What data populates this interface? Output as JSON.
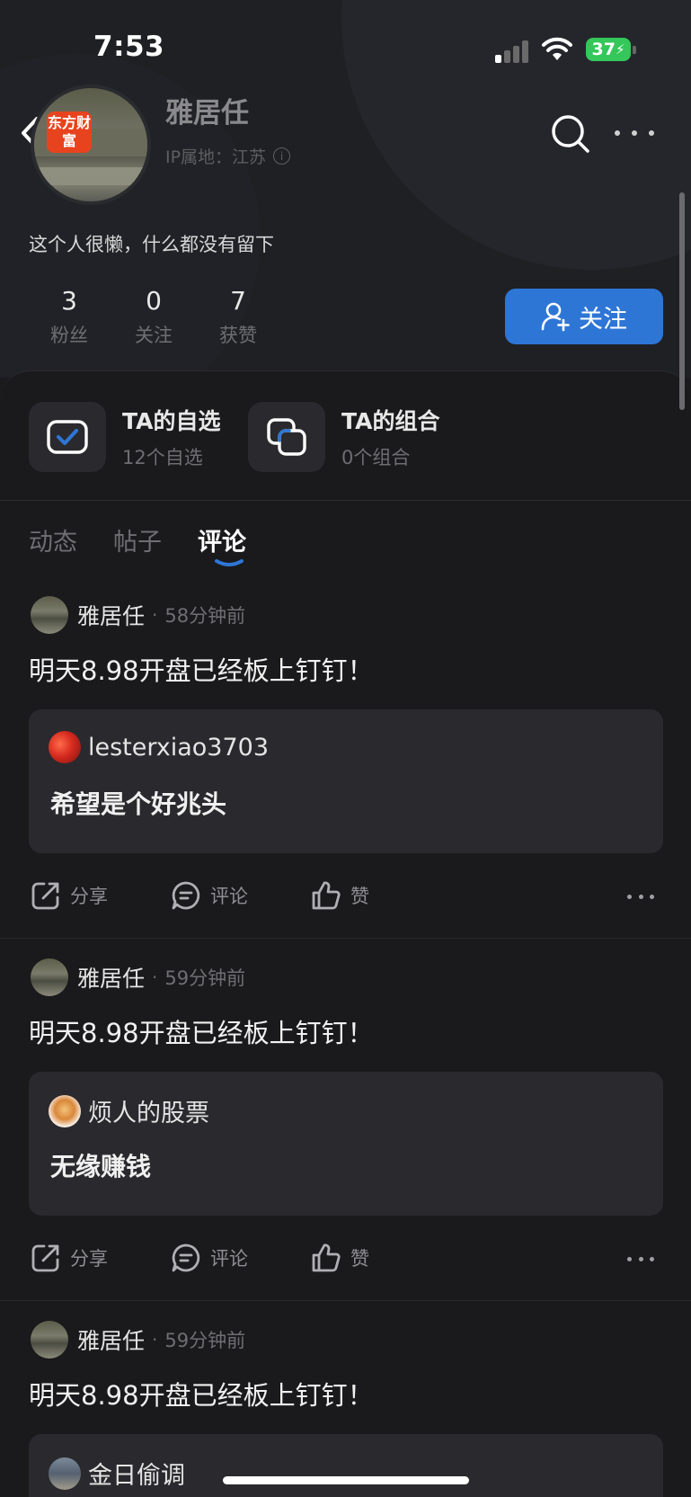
{
  "status_bar": {
    "time": "7:53",
    "battery": "37"
  },
  "profile": {
    "logo_text": "东方财富",
    "name": "雅居任",
    "ip_location": "IP属地：江苏",
    "bio": "这个人很懒，什么都没有留下",
    "stats": [
      {
        "value": "3",
        "label": "粉丝"
      },
      {
        "value": "0",
        "label": "关注"
      },
      {
        "value": "7",
        "label": "获赞"
      }
    ],
    "follow_label": "关注"
  },
  "shortcuts": [
    {
      "title": "TA的自选",
      "subtitle": "12个自选",
      "icon": "checkbox-icon"
    },
    {
      "title": "TA的组合",
      "subtitle": "0个组合",
      "icon": "portfolio-icon"
    }
  ],
  "tabs": [
    {
      "label": "动态",
      "active": false
    },
    {
      "label": "帖子",
      "active": false
    },
    {
      "label": "评论",
      "active": true
    }
  ],
  "comments": [
    {
      "user": "雅居任",
      "dot": "·",
      "time": "58分钟前",
      "text": "明天8.98开盘已经板上钉钉！",
      "quote_user": "lesterxiao3703",
      "quote_text": "希望是个好兆头"
    },
    {
      "user": "雅居任",
      "dot": "·",
      "time": "59分钟前",
      "text": "明天8.98开盘已经板上钉钉！",
      "quote_user": "烦人的股票",
      "quote_text": "无缘赚钱"
    },
    {
      "user": "雅居任",
      "dot": "·",
      "time": "59分钟前",
      "text": "明天8.98开盘已经板上钉钉！",
      "quote_user": "金日偷调",
      "quote_text": ""
    }
  ],
  "actions": {
    "share": "分享",
    "comment": "评论",
    "like": "赞"
  },
  "colors": {
    "accent": "#2e76d6",
    "background": "#1a1a1c",
    "card": "#2a2a2e"
  }
}
